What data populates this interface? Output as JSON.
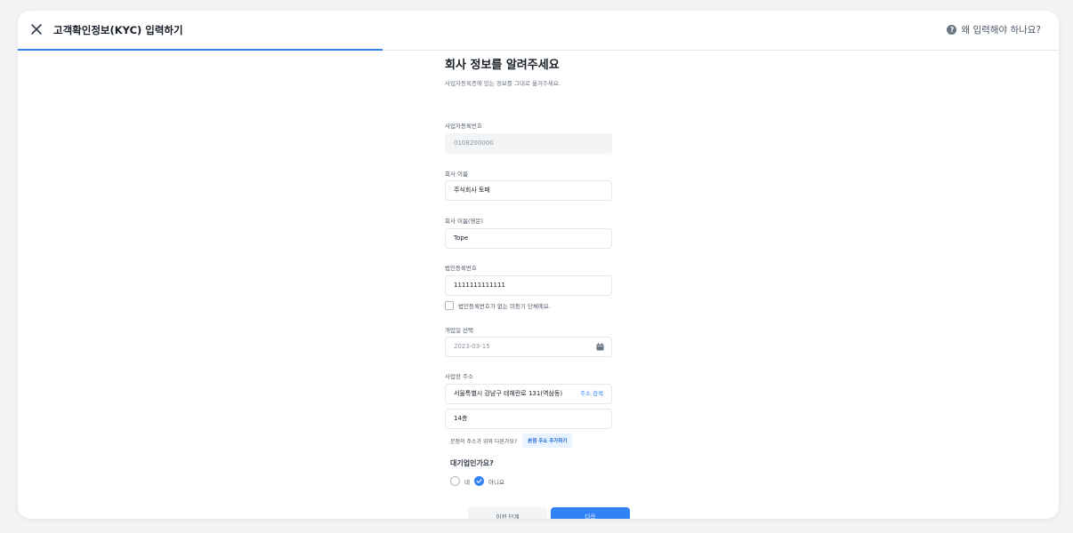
{
  "header": {
    "title": "고객확인정보(KYC) 입력하기",
    "help_label": "왜 입력해야 하나요?",
    "progress_percent": 35
  },
  "page": {
    "title": "회사 정보를 알려주세요",
    "subtitle": "사업자등록증에 있는 정보를 그대로 옮겨주세요."
  },
  "form": {
    "business_number": {
      "label": "사업자등록번호",
      "value": "0108200000"
    },
    "company_name": {
      "label": "회사 이름",
      "value": "주식회사 토페"
    },
    "company_name_en": {
      "label": "회사 이름(영문)",
      "value": "Tope"
    },
    "corp_number": {
      "label": "법인등록번호",
      "value": "1111111111111"
    },
    "no_corp_number": {
      "label": "법인등록번호가 없는 미등기 단체에요.",
      "checked": false
    },
    "open_date": {
      "label": "개업일 선택",
      "value": "2023-03-15",
      "icon": "calendar-icon"
    },
    "address": {
      "label": "사업장 주소",
      "value": "서울특별시 강남구 테헤란로 131(역삼동)",
      "search_label": "주소 검색",
      "detail": "14층"
    },
    "hq": {
      "question": "본점의 주소가 위와 다른가요?",
      "button_label": "본점 주소 추가하기"
    },
    "large_company": {
      "question": "대기업인가요?",
      "options": [
        {
          "label": "네",
          "checked": false
        },
        {
          "label": "아니요",
          "checked": true
        }
      ]
    }
  },
  "actions": {
    "prev_label": "이전 단계",
    "next_label": "다음"
  },
  "colors": {
    "accent": "#3182f6",
    "text": "#191f28",
    "muted": "#8b95a1"
  }
}
